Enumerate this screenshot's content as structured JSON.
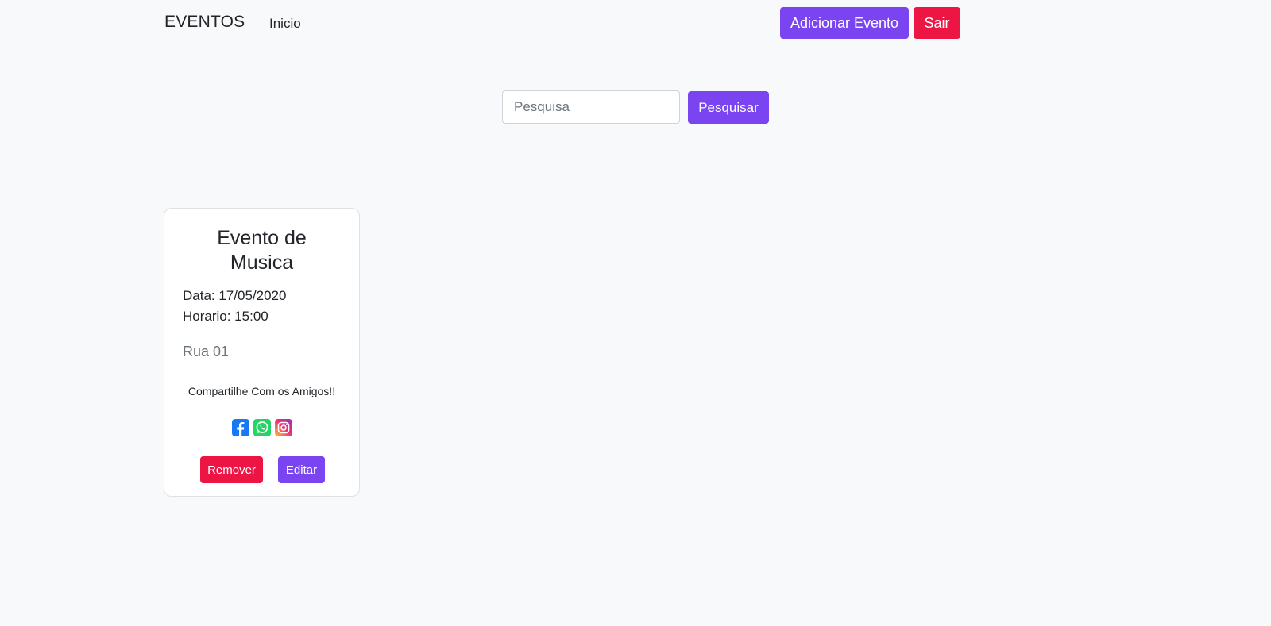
{
  "navbar": {
    "brand": "EVENTOS",
    "home_link": "Inicio",
    "add_event_label": "Adicionar Evento",
    "logout_label": "Sair"
  },
  "search": {
    "placeholder": "Pesquisa",
    "value": "",
    "button_label": "Pesquisar"
  },
  "events": [
    {
      "title_line1": "Evento de",
      "title_line2": "Musica",
      "date": "Data: 17/05/2020",
      "time": "Horario: 15:00",
      "address": "Rua 01",
      "share_text": "Compartilhe Com os Amigos!!",
      "social_icons": [
        "facebook-icon",
        "whatsapp-icon",
        "instagram-icon"
      ],
      "remove_label": "Remover",
      "edit_label": "Editar"
    }
  ],
  "colors": {
    "primary": "#7a45f0",
    "danger": "#ed1544",
    "background": "#f8f9fa"
  }
}
